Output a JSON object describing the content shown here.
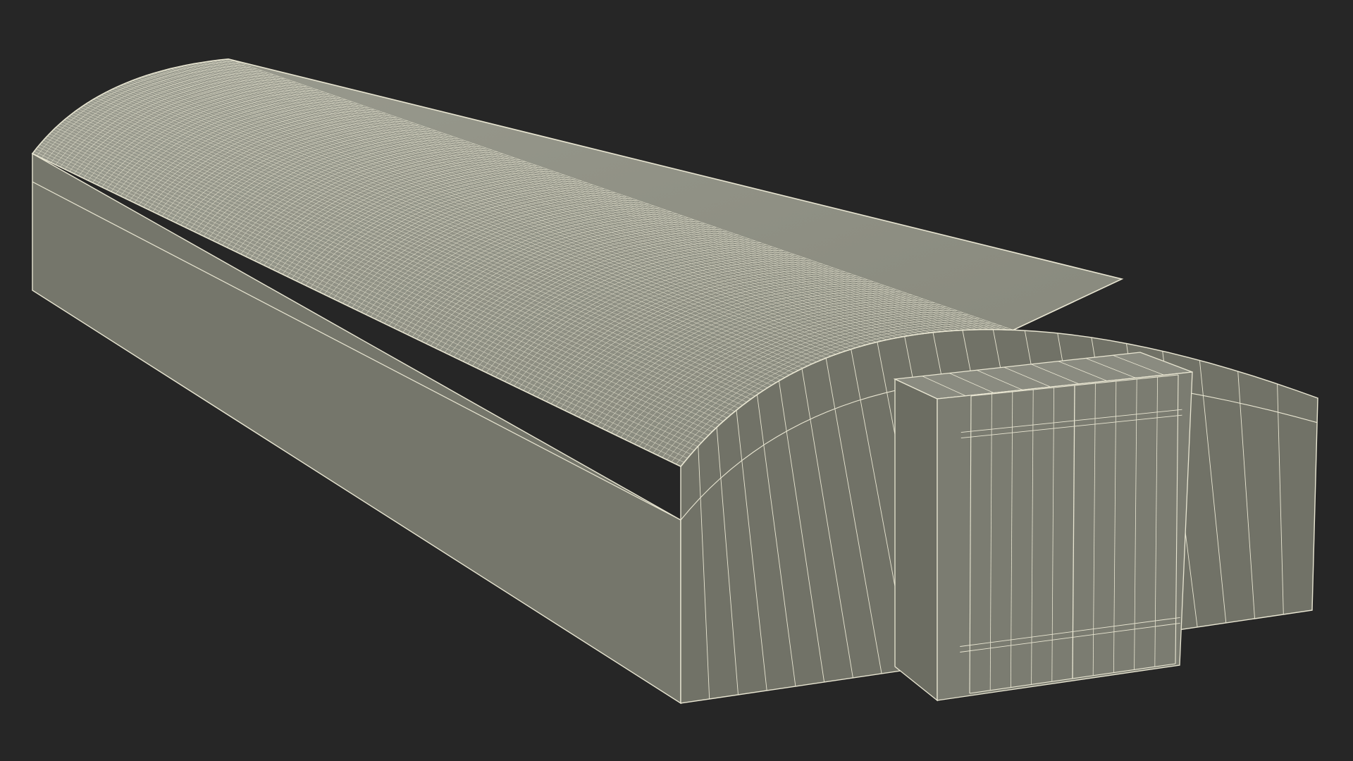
{
  "scene": {
    "subject": "quonset-hut-wireframe-render",
    "background_color": "#262626",
    "surface_color": "#75766b",
    "roof_color": "#8e8f84",
    "wire_color": "#e9e6d2"
  }
}
